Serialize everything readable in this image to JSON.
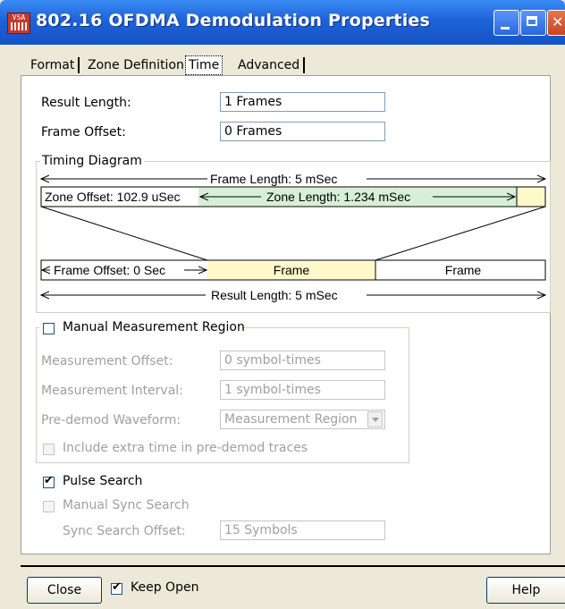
{
  "window": {
    "title": "802.16 OFDMA Demodulation Properties",
    "icon_text": "VSA",
    "title_bar_color": "#1f61d9"
  },
  "tabs": [
    {
      "label": "Format"
    },
    {
      "label": "Zone Definition"
    },
    {
      "label": "Time",
      "active": true
    },
    {
      "label": "Advanced"
    }
  ],
  "form": {
    "result_length_label": "Result Length:",
    "result_length_value": "1 Frames",
    "frame_offset_label": "Frame Offset:",
    "frame_offset_value": "0 Frames"
  },
  "timing_diagram": {
    "title": "Timing Diagram",
    "frame_length": "Frame Length:  5 mSec",
    "zone_offset": "Zone Offset: 102.9 uSec",
    "zone_length": "Zone Length: 1.234 mSec",
    "frame_offset": "Frame Offset: 0 Sec",
    "frame_1": "Frame",
    "frame_2": "Frame",
    "result_length": "Result Length: 5 mSec",
    "zone_color": "#d6f0d8",
    "frame_color": "#fff9c9"
  },
  "measurement": {
    "title": "Manual Measurement Region",
    "enabled": false,
    "offset_label": "Measurement Offset:",
    "offset_value": "0 symbol-times",
    "interval_label": "Measurement Interval:",
    "interval_value": "1 symbol-times",
    "waveform_label": "Pre-demod Waveform:",
    "waveform_value": "Measurement Region",
    "include_extra_label": "Include extra time in pre-demod traces"
  },
  "pulse": {
    "pulse_search_label": "Pulse Search",
    "pulse_search_checked": true,
    "manual_sync_label": "Manual Sync Search",
    "sync_offset_label": "Sync Search Offset:",
    "sync_offset_value": "15 Symbols"
  },
  "footer": {
    "close_label": "Close",
    "keep_open_label": "Keep Open",
    "keep_open_checked": true,
    "help_label": "Help"
  }
}
